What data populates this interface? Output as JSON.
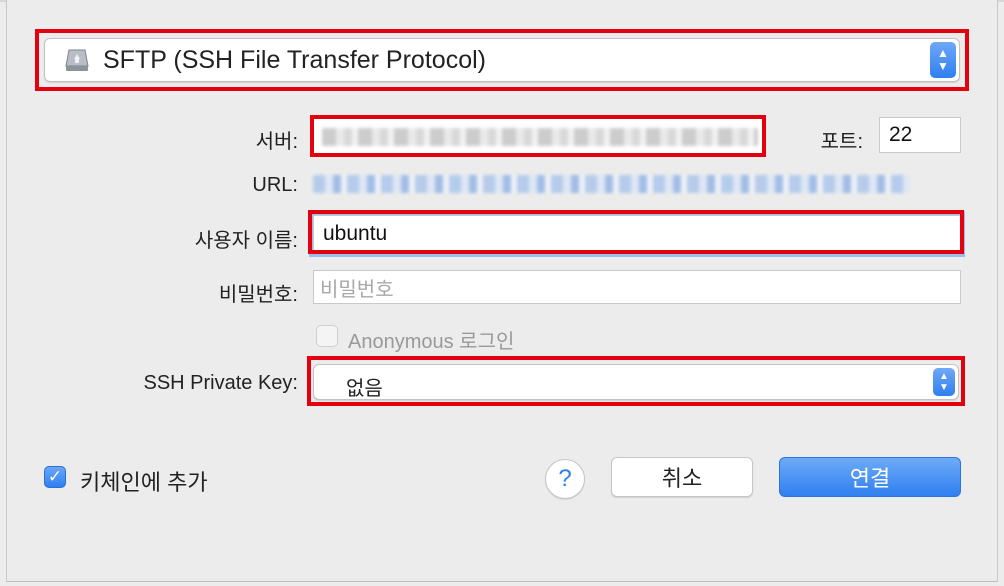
{
  "protocol": {
    "selected": "SFTP (SSH File Transfer Protocol)",
    "icon": "network-disk-icon"
  },
  "server": {
    "label": "서버:",
    "value": ""
  },
  "port": {
    "label": "포트:",
    "value": "22"
  },
  "url": {
    "label": "URL:",
    "value": ""
  },
  "username": {
    "label": "사용자 이름:",
    "value": "ubuntu"
  },
  "password": {
    "label": "비밀번호:",
    "placeholder": "비밀번호"
  },
  "anonymous": {
    "label": "Anonymous 로그인",
    "checked": false,
    "enabled": false
  },
  "ssh_key": {
    "label": "SSH Private Key:",
    "selected": "없음"
  },
  "keychain": {
    "label": "키체인에 추가",
    "checked": true
  },
  "help": {
    "label": "?"
  },
  "buttons": {
    "cancel": "취소",
    "connect": "연결"
  },
  "colors": {
    "accent": "#2f7ff0",
    "highlight": "#e3000f"
  }
}
